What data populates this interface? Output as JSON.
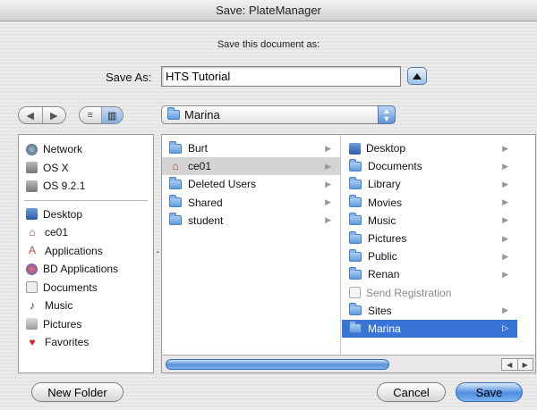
{
  "window": {
    "title": "Save: PlateManager"
  },
  "dialog": {
    "prompt": "Save this document as:",
    "save_as_label": "Save As:",
    "save_as_value": "HTS Tutorial"
  },
  "toolbar": {
    "nav_back": "◀",
    "nav_forward": "▶",
    "view_list": "≡",
    "view_columns": "▥",
    "location": "Marina"
  },
  "sidebar": {
    "devices": [
      {
        "label": "Network",
        "icon": "network-icon"
      },
      {
        "label": "OS X",
        "icon": "disk-icon"
      },
      {
        "label": "OS 9.2.1",
        "icon": "disk-icon"
      }
    ],
    "places": [
      {
        "label": "Desktop",
        "icon": "desktop-icon"
      },
      {
        "label": "ce01",
        "icon": "home-icon"
      },
      {
        "label": "Applications",
        "icon": "applications-icon"
      },
      {
        "label": "BD Applications",
        "icon": "app-folder-icon"
      },
      {
        "label": "Documents",
        "icon": "documents-icon"
      },
      {
        "label": "Music",
        "icon": "music-icon"
      },
      {
        "label": "Pictures",
        "icon": "pictures-icon"
      },
      {
        "label": "Favorites",
        "icon": "heart-icon"
      }
    ]
  },
  "browser": {
    "column1": [
      {
        "label": "Burt",
        "icon": "folder-icon"
      },
      {
        "label": "ce01",
        "icon": "home-icon",
        "selected": true
      },
      {
        "label": "Deleted Users",
        "icon": "folder-icon"
      },
      {
        "label": "Shared",
        "icon": "folder-icon"
      },
      {
        "label": "student",
        "icon": "folder-icon"
      }
    ],
    "column2": [
      {
        "label": "Desktop",
        "icon": "desktop-icon"
      },
      {
        "label": "Documents",
        "icon": "folder-icon"
      },
      {
        "label": "Library",
        "icon": "folder-icon"
      },
      {
        "label": "Movies",
        "icon": "folder-icon"
      },
      {
        "label": "Music",
        "icon": "folder-icon"
      },
      {
        "label": "Pictures",
        "icon": "folder-icon"
      },
      {
        "label": "Public",
        "icon": "folder-icon"
      },
      {
        "label": "Renan",
        "icon": "folder-icon"
      },
      {
        "label": "Send Registration",
        "icon": "file-icon",
        "disabled": true
      },
      {
        "label": "Sites",
        "icon": "folder-icon"
      },
      {
        "label": "Marina",
        "icon": "folder-icon",
        "selected": true
      }
    ]
  },
  "buttons": {
    "new_folder": "New Folder",
    "cancel": "Cancel",
    "save": "Save"
  },
  "colors": {
    "selection": "#3875d7",
    "accent": "#5f93d6"
  }
}
